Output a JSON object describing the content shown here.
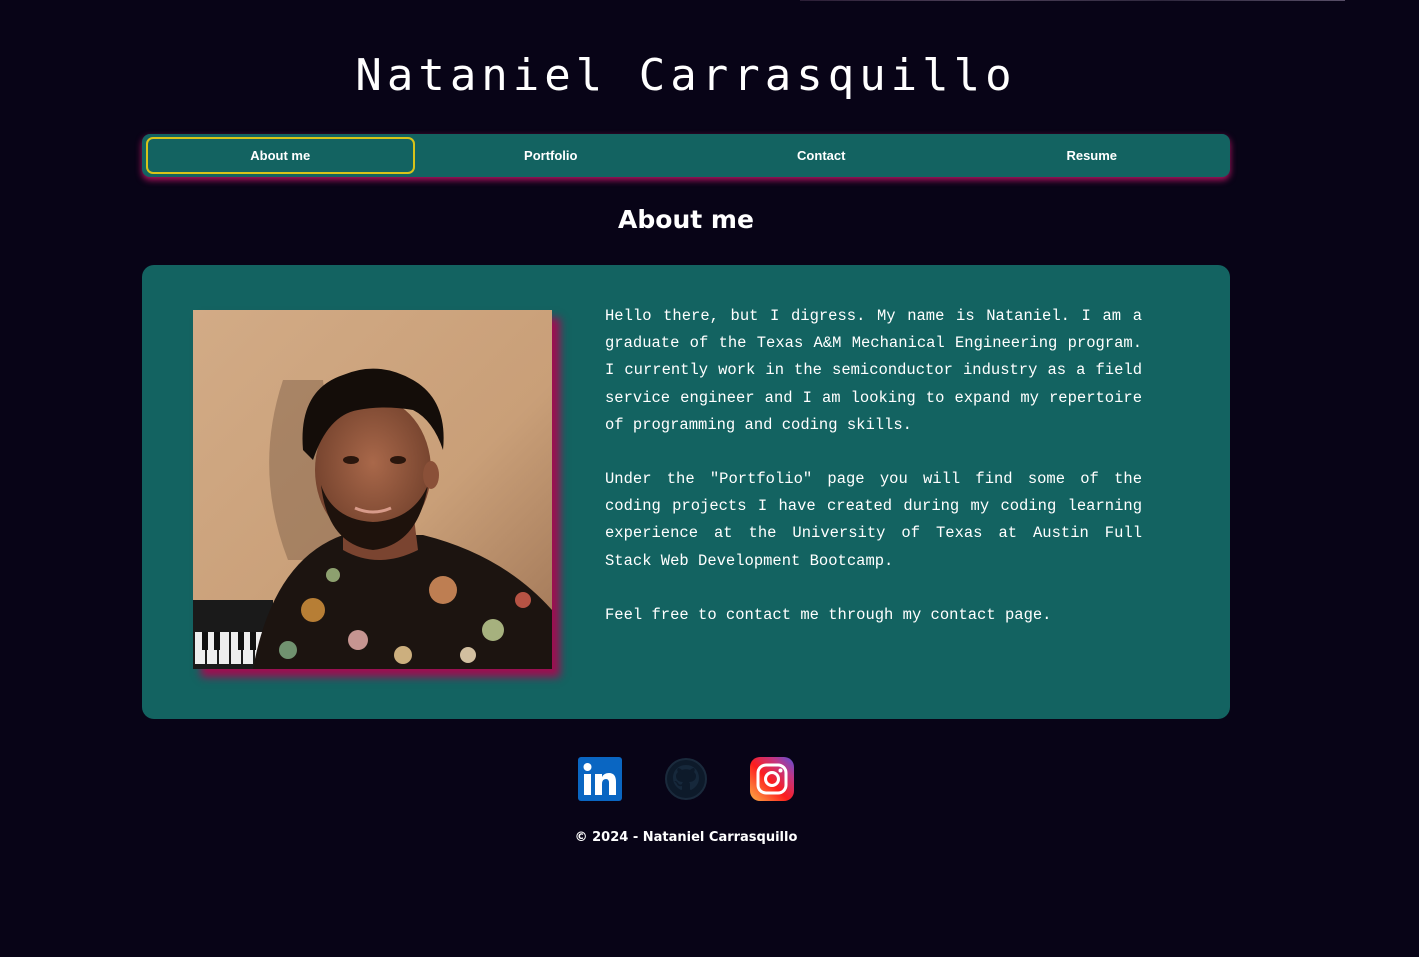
{
  "site": {
    "title": "Nataniel Carrasquillo"
  },
  "nav": {
    "items": [
      {
        "label": "About me",
        "active": true
      },
      {
        "label": "Portfolio",
        "active": false
      },
      {
        "label": "Contact",
        "active": false
      },
      {
        "label": "Resume",
        "active": false
      }
    ]
  },
  "about": {
    "heading": "About me",
    "photo_icon": "profile-photo",
    "paragraphs": [
      "Hello there, but I digress. My name is Nataniel. I am a graduate of the Texas A&M Mechanical Engineering program. I currently work in the semiconductor industry as a field service engineer and I am looking to expand my repertoire of programming and coding skills.",
      "Under the \"Portfolio\" page you will find some of the coding projects I have created during my coding learning experience at the University of Texas at Austin Full Stack Web Development Bootcamp.",
      "Feel free to contact me through my contact page."
    ]
  },
  "social": {
    "links": [
      {
        "icon": "linkedin-icon"
      },
      {
        "icon": "github-icon"
      },
      {
        "icon": "instagram-icon"
      }
    ]
  },
  "footer": {
    "text": "© 2024 - Nataniel Carrasquillo"
  },
  "colors": {
    "background": "#080417",
    "panel": "#136361",
    "accent_shadow": "#d2196e",
    "active_border": "#d8c31a"
  }
}
